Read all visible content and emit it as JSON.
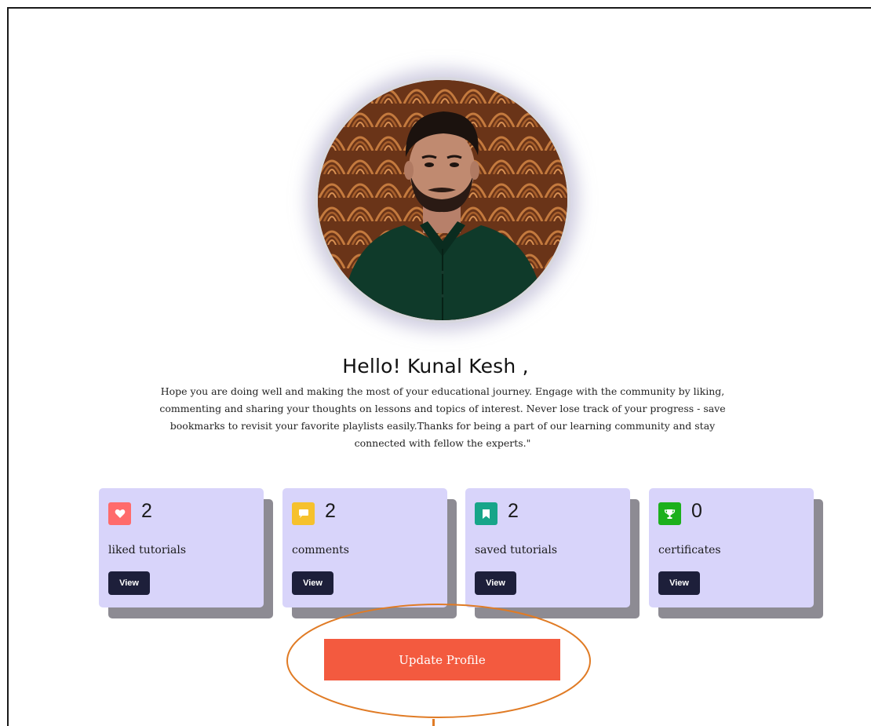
{
  "profile": {
    "greeting": "Hello! Kunal Kesh ,",
    "intro": "Hope you are doing well and making the most of your educational journey. Engage with the community by liking, commenting and sharing your thoughts on lessons and topics of interest. Never lose track of your progress - save bookmarks to revisit your favorite playlists easily.Thanks for being a part of our learning community and stay connected with fellow the experts.\""
  },
  "stats": [
    {
      "icon": "heart-icon",
      "color": "#ff6b6b",
      "count": "2",
      "label": "liked tutorials",
      "button": "View"
    },
    {
      "icon": "comment-icon",
      "color": "#f6c12c",
      "count": "2",
      "label": "comments",
      "button": "View"
    },
    {
      "icon": "bookmark-icon",
      "color": "#17a589",
      "count": "2",
      "label": "saved tutorials",
      "button": "View"
    },
    {
      "icon": "trophy-icon",
      "color": "#1cb01c",
      "count": "0",
      "label": "certificates",
      "button": "View"
    }
  ],
  "actions": {
    "update_profile": "Update Profile"
  },
  "colors": {
    "card_bg": "#d8d4fa",
    "card_shadow": "#8d8b93",
    "button_dark": "#1d1f3a",
    "accent": "#f35a3f",
    "annotation": "#e07b25"
  }
}
